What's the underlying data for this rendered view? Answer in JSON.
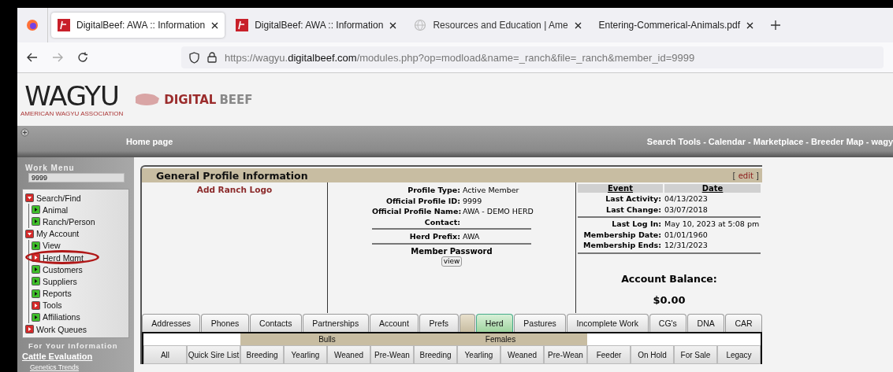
{
  "browser": {
    "tabs": [
      {
        "title": "DigitalBeef: AWA :: Information",
        "kind": "site",
        "selected": true
      },
      {
        "title": "DigitalBeef: AWA :: Information",
        "kind": "site",
        "selected": false
      },
      {
        "title": "Resources and Education | Ame",
        "kind": "faded",
        "selected": false
      },
      {
        "title": "Entering-Commerical-Animals.pdf",
        "kind": "document",
        "selected": false
      }
    ],
    "forward_disabled": true,
    "url": {
      "scheme": "https://wagyu.",
      "domain": "digitalbeef.com",
      "path": "/modules.php?op=modload&name=_ranch&file=_ranch&member_id=9999"
    }
  },
  "header": {
    "logo_name": "WAGYU",
    "logo_subtitle": "AMERICAN WAGYU ASSOCIATION",
    "brand": [
      "DIGITAL",
      "BEEF"
    ],
    "home_link": "Home page",
    "top_links": "Search Tools - Calendar - Marketplace - Breeder Map - wagy"
  },
  "sidebar": {
    "work_menu_label": "Work Menu",
    "work_menu_value": "9999",
    "menu": [
      {
        "label": "Search/Find",
        "kind": "folder",
        "expanded": true,
        "children": [
          {
            "label": "Animal",
            "kind": "page",
            "circled": false
          },
          {
            "label": "Ranch/Person",
            "kind": "page",
            "circled": false
          }
        ]
      },
      {
        "label": "My Account",
        "kind": "folder",
        "expanded": true,
        "children": [
          {
            "label": "View",
            "kind": "page",
            "circled": false
          },
          {
            "label": "Herd Mgmt",
            "kind": "folder",
            "circled": true
          },
          {
            "label": "Customers",
            "kind": "page",
            "circled": false
          },
          {
            "label": "Suppliers",
            "kind": "page",
            "circled": false
          },
          {
            "label": "Reports",
            "kind": "page",
            "circled": false
          },
          {
            "label": "Tools",
            "kind": "folder",
            "circled": false
          },
          {
            "label": "Affiliations",
            "kind": "page",
            "circled": false
          }
        ]
      },
      {
        "label": "Work Queues",
        "kind": "folder",
        "expanded": false
      }
    ],
    "info_heading": "For Your Information",
    "info_links": [
      "Cattle Evaluation",
      "Genetics Trends"
    ]
  },
  "profile": {
    "title": "General Profile Information",
    "edit_link": "edit",
    "edit_brackets": [
      "[",
      "]"
    ],
    "add_logo": "Add Ranch Logo",
    "field_groups": [
      [
        {
          "label": "Profile Type:",
          "value": "Active Member"
        },
        {
          "label": "Official Profile ID:",
          "value": "9999"
        },
        {
          "label": "Official Profile Name:",
          "value": "AWA - DEMO HERD"
        },
        {
          "label": "Contact:"
        }
      ],
      [
        {
          "label": "Herd Prefix:",
          "value": "AWA"
        }
      ]
    ],
    "password_label": "Member Password",
    "password_button": "view",
    "event_columns": [
      "Event",
      "Date"
    ],
    "event_groups": [
      [
        {
          "label": "Last Activity:",
          "value": "04/13/2023"
        },
        {
          "label": "Last Change:",
          "value": "03/07/2018"
        }
      ],
      [
        {
          "label": "Last Log In:",
          "value": "May 10, 2023 at 5:08 pm"
        },
        {
          "label": "Membership Date:",
          "value": "01/01/1960"
        },
        {
          "label": "Membership Ends:",
          "value": "12/31/2023"
        }
      ]
    ],
    "balance_label": "Account Balance:",
    "balance_value": "$0.00"
  },
  "tabs": [
    {
      "label": "Addresses",
      "selected": false
    },
    {
      "label": "Phones",
      "selected": false
    },
    {
      "label": "Contacts",
      "selected": false
    },
    {
      "label": "Partnerships",
      "selected": false
    },
    {
      "label": "Account",
      "selected": false
    },
    {
      "label": "Prefs",
      "selected": false
    },
    {
      "kind": "blank",
      "selected": false
    },
    {
      "label": "Herd",
      "selected": true
    },
    {
      "label": "Pastures",
      "selected": false
    },
    {
      "label": "Incomplete Work",
      "selected": false
    },
    {
      "label": "CG's",
      "selected": false
    },
    {
      "label": "DNA",
      "selected": false
    },
    {
      "label": "CAR",
      "selected": false
    }
  ],
  "herd_filters": [
    {
      "kind": "plain",
      "buttons": [
        "All",
        "Quick Sire List"
      ]
    },
    {
      "kind": "labeled",
      "label": "Bulls",
      "buttons": [
        "Breeding",
        "Yearling",
        "Weaned",
        "Pre-Wean"
      ]
    },
    {
      "kind": "labeled",
      "label": "Females",
      "buttons": [
        "Breeding",
        "Yearling",
        "Weaned",
        "Pre-Wean"
      ]
    },
    {
      "kind": "plain",
      "buttons": [
        "Feeder",
        "On Hold",
        "For Sale",
        "Legacy"
      ]
    }
  ]
}
